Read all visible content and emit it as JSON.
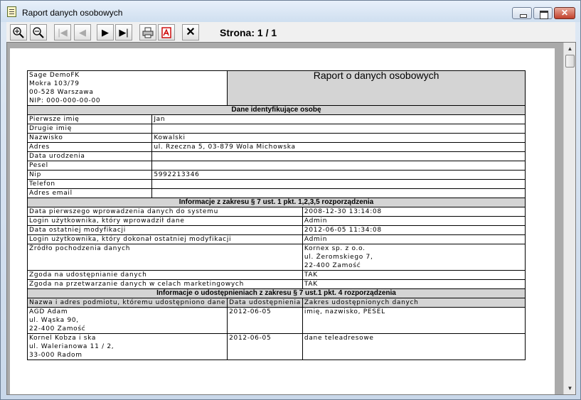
{
  "window": {
    "title": "Raport danych osobowych"
  },
  "toolbar": {
    "page_label": "Strona: 1 / 1",
    "first_icon": "|◀",
    "prev_icon": "◀",
    "next_icon": "▶",
    "last_icon": "▶|",
    "close_icon": "✕"
  },
  "report": {
    "company": [
      "Sage DemoFK",
      "Mokra 103/79",
      "00-528 Warszawa",
      "NIP: 000-000-00-00"
    ],
    "title": "Raport o danych osobowych",
    "section1": {
      "title": "Dane identyfikujące osobę",
      "rows": [
        {
          "label": "Pierwsze imię",
          "value": "Jan"
        },
        {
          "label": "Drugie imię",
          "value": ""
        },
        {
          "label": "Nazwisko",
          "value": "Kowalski"
        },
        {
          "label": "Adres",
          "value": "ul. Rzeczna 5,  03-879 Wola Michowska"
        },
        {
          "label": "Data urodzenia",
          "value": ""
        },
        {
          "label": "Pesel",
          "value": ""
        },
        {
          "label": "Nip",
          "value": "5992213346"
        },
        {
          "label": "Telefon",
          "value": ""
        },
        {
          "label": "Adres email",
          "value": ""
        }
      ]
    },
    "section2": {
      "title": "Informacje z zakresu § 7 ust. 1 pkt. 1,2,3,5 rozporządzenia",
      "rows": [
        {
          "label": "Data pierwszego wprowadzenia danych do systemu",
          "value": "2008-12-30 13:14:08"
        },
        {
          "label": "Login użytkownika, który wprowadził dane",
          "value": "Admin"
        },
        {
          "label": "Data ostatniej modyfikacji",
          "value": "2012-06-05 11:34:08"
        },
        {
          "label": "Login użytkownika, który dokonał ostatniej modyfikacji",
          "value": "Admin"
        },
        {
          "label": "Źródło pochodzenia danych",
          "value_lines": [
            "Kornex sp. z o.o.",
            "ul. Żeromskiego 7,",
            "22-400 Zamość"
          ]
        },
        {
          "label": "Zgoda na udostępnianie danych",
          "value": "TAK"
        },
        {
          "label": "Zgoda na przetwarzanie danych w celach marketingowych",
          "value": "TAK"
        }
      ]
    },
    "section3": {
      "title": "Informacje o udostępnieniach z zakresu § 7 ust.1 pkt. 4 rozporządzenia",
      "columns": [
        "Nazwa i adres podmiotu, któremu udostępniono dane",
        "Data udostępnienia",
        "Zakres udostępnionych danych"
      ],
      "rows": [
        {
          "entity": [
            "AGD Adam",
            "ul. Wąska 90,",
            "22-400 Zamość"
          ],
          "date": "2012-06-05",
          "scope": "imię, nazwisko, PESEL"
        },
        {
          "entity": [
            "Kornel Kobza i ska",
            "ul. Walerianowa 11 / 2,",
            "33-000 Radom"
          ],
          "date": "2012-06-05",
          "scope": "dane teleadresowe"
        }
      ]
    }
  }
}
